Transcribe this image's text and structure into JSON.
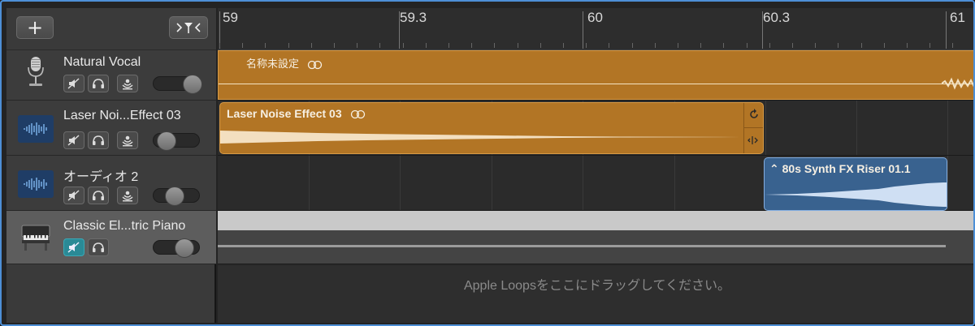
{
  "toolbar": {
    "add_track_label": "+",
    "filter_label": ">Y<"
  },
  "ruler": {
    "marks": [
      "59",
      "59.3",
      "60",
      "60.3",
      "61"
    ]
  },
  "tracks": [
    {
      "name": "Natural Vocal",
      "icon": "microphone-icon",
      "mute_on": false,
      "volume": 0.82
    },
    {
      "name": "Laser Noi...Effect 03",
      "icon": "waveform-icon",
      "mute_on": false,
      "volume": 0.3
    },
    {
      "name": "オーディオ 2",
      "icon": "waveform-icon",
      "mute_on": false,
      "volume": 0.45
    },
    {
      "name": "Classic El...tric Piano",
      "icon": "piano-icon",
      "mute_on": true,
      "volume": 0.65
    }
  ],
  "regions": {
    "vocal": {
      "name": "名称未設定"
    },
    "laser": {
      "name": "Laser Noise Effect 03"
    },
    "synth": {
      "name": "80s Synth FX Riser 01.1"
    }
  },
  "arrange": {
    "drop_hint": "Apple Loopsをここにドラッグしてください。"
  },
  "colors": {
    "accent": "#4d8fd6",
    "audio_region": "#b27525",
    "loop_region": "#39628f",
    "mute_active": "#2a8a96"
  }
}
